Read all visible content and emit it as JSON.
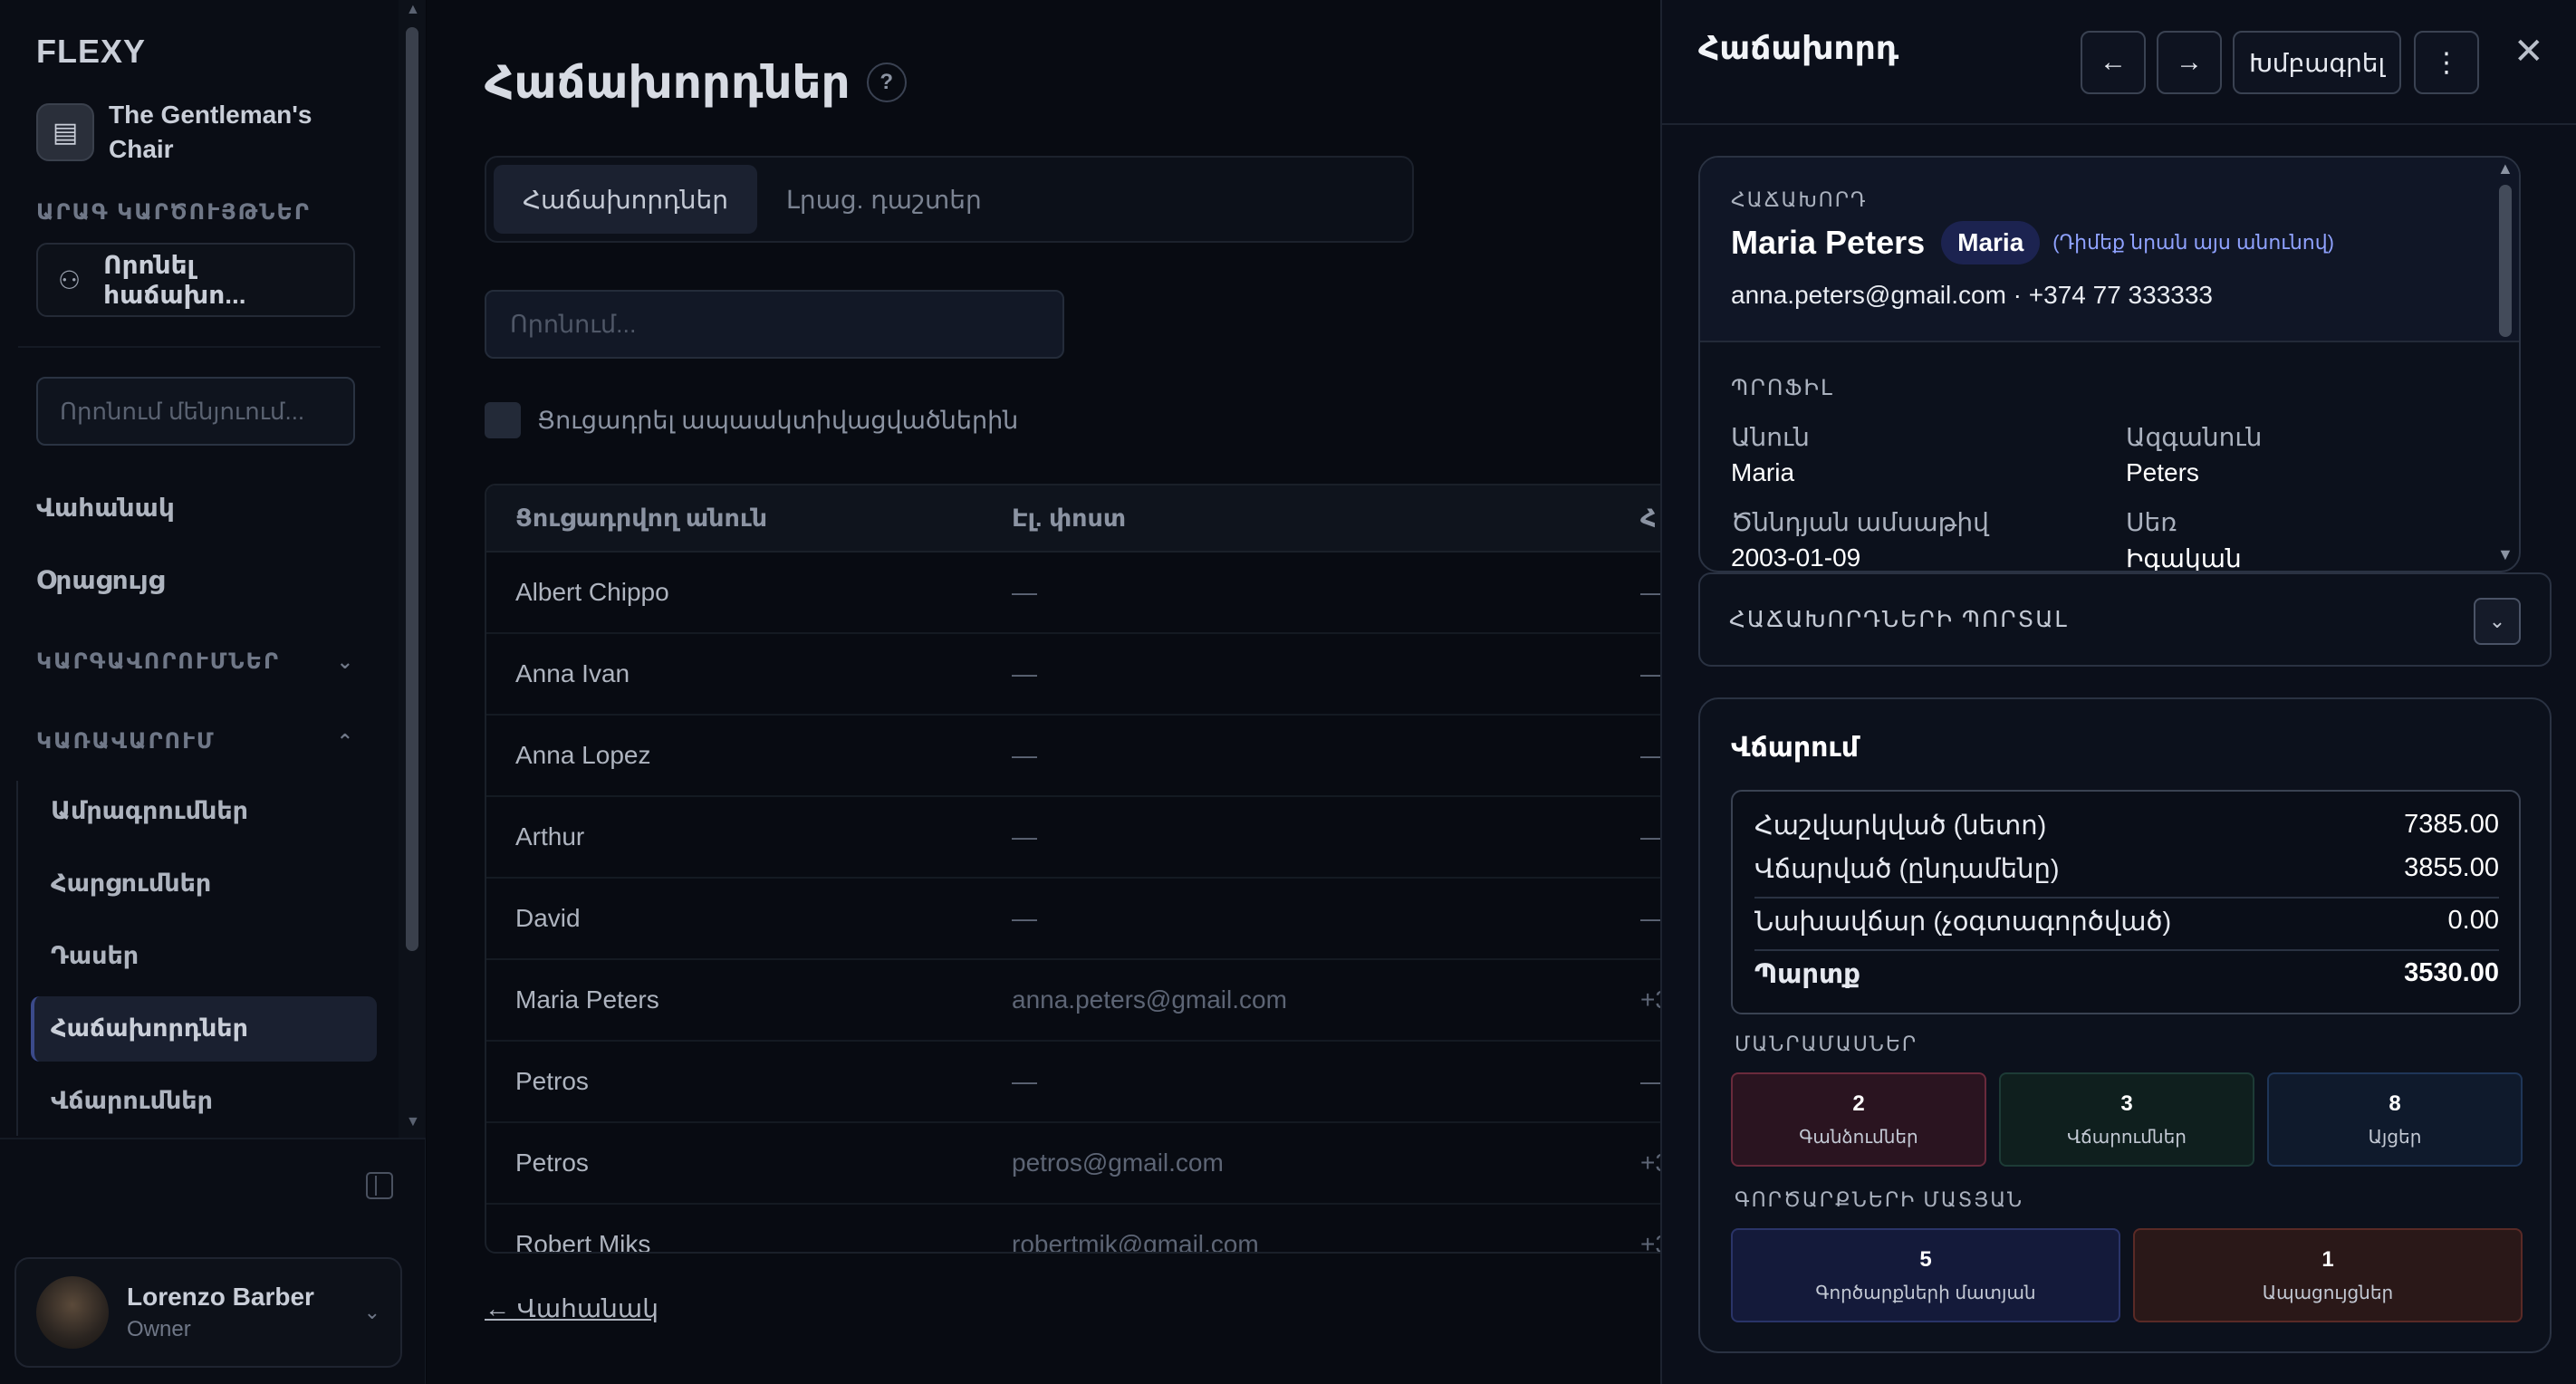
{
  "sidebar": {
    "brand": "FLEXY",
    "org_name": "The Gentleman's Chair",
    "quick_actions_label": "ԱՐԱԳ ԿԱՐԾՈՒՅԹՆԵՐ",
    "find_client_label": "Որոնել հաճախո...",
    "menu_search_placeholder": "Որոնում մենյուում...",
    "nav_home": "Վահանակ",
    "nav_calendar": "Օրացույց",
    "group_settings": "ԿԱՐԳԱՎՈՐՈՒՄՆԵՐ",
    "group_management": "ԿԱՌԱՎԱՐՈՒՄ",
    "sub_items": [
      "Ամրագրումներ",
      "Հարցումներ",
      "Դասեր",
      "Հաճախորդներ",
      "Վճարումներ"
    ],
    "user_name": "Lorenzo Barber",
    "user_role": "Owner"
  },
  "main": {
    "title": "Հաճախորդներ",
    "help": "?",
    "tabs": [
      "Հաճախորդներ",
      "Լրաց. դաշտեր"
    ],
    "search_placeholder": "Որոնում...",
    "show_archived_label": "Ցուցադրել ապաակտիվացվածներին",
    "columns": [
      "Ցուցադրվող անուն",
      "Էլ. փոստ",
      "Հ"
    ],
    "rows": [
      {
        "name": "Albert Chippo",
        "email": "—",
        "phone": "—"
      },
      {
        "name": "Anna Ivan",
        "email": "—",
        "phone": "—"
      },
      {
        "name": "Anna Lopez",
        "email": "—",
        "phone": "—"
      },
      {
        "name": "Arthur",
        "email": "—",
        "phone": "—"
      },
      {
        "name": "David",
        "email": "—",
        "phone": "—"
      },
      {
        "name": "Maria Peters",
        "email": "anna.peters@gmail.com",
        "phone": "+3"
      },
      {
        "name": "Petros",
        "email": "—",
        "phone": "—"
      },
      {
        "name": "Petros",
        "email": "petros@gmail.com",
        "phone": "+3"
      },
      {
        "name": "Robert Miks",
        "email": "robertmik@gmail.com",
        "phone": "+3"
      }
    ],
    "back_link": "← Վահանակ"
  },
  "drawer": {
    "title": "Հաճախորդ",
    "prev": "←",
    "next": "→",
    "edit": "Խմբագրել",
    "more": "⋮",
    "close": "✕",
    "client_label": "ՀԱՃԱԽՈՐԴ",
    "client_name": "Maria Peters",
    "nickname": "Maria",
    "nickname_note": "(Դիմեք նրան այս անունով)",
    "contact": "anna.peters@gmail.com · +374 77 333333",
    "profile_label": "ՊՐՈՖԻԼ",
    "first_name_label": "Անուն",
    "first_name": "Maria",
    "last_name_label": "Ազգանուն",
    "last_name": "Peters",
    "dob_label": "Ծննդյան ամսաթիվ",
    "dob": "2003-01-09",
    "gender_label": "Սեռ",
    "gender": "Իգական",
    "portal_label": "ՀԱՃԱԽՈՐԴՆԵՐԻ ՊՈՐՏԱԼ",
    "payment_title": "Վճարում",
    "payments": [
      {
        "label": "Հաշվարկված (նետո)",
        "value": "7385.00"
      },
      {
        "label": "Վճարված (ընդամենը)",
        "value": "3855.00"
      },
      {
        "label": "Նախավճար (չօգտագործված)",
        "value": "0.00"
      },
      {
        "label": "Պարտք",
        "value": "3530.00"
      }
    ],
    "details_label": "ՄԱՆՐԱՄԱՍՆԵՐ",
    "details": [
      {
        "count": "2",
        "label": "Գանձումներ"
      },
      {
        "count": "3",
        "label": "Վճարումներ"
      },
      {
        "count": "8",
        "label": "Այցեր"
      }
    ],
    "ops_label": "ԳՈՐԾԱՐՔՆԵՐԻ ՄԱՏՅԱՆ",
    "ops": [
      {
        "count": "5",
        "label": "Գործարքների մատյան"
      },
      {
        "count": "1",
        "label": "Ապացույցներ"
      }
    ]
  }
}
